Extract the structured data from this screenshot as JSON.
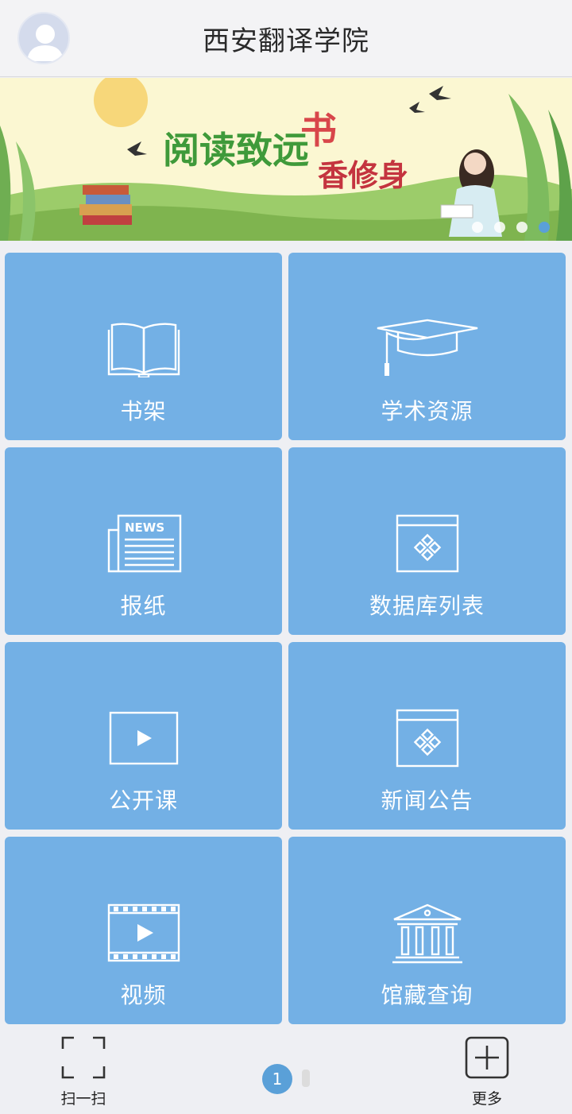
{
  "header": {
    "title": "西安翻译学院"
  },
  "banner": {
    "slogan_left": "阅读致远",
    "slogan_right_top": "书",
    "slogan_right_bottom": "香修身",
    "slide_count": 4,
    "active_slide": 4
  },
  "tiles": [
    {
      "label": "书架",
      "icon": "open-book-icon"
    },
    {
      "label": "学术资源",
      "icon": "graduation-cap-icon"
    },
    {
      "label": "报纸",
      "icon": "newspaper-icon",
      "icon_text": "NEWS"
    },
    {
      "label": "数据库列表",
      "icon": "database-window-icon"
    },
    {
      "label": "公开课",
      "icon": "play-screen-icon"
    },
    {
      "label": "新闻公告",
      "icon": "news-window-icon"
    },
    {
      "label": "视频",
      "icon": "film-play-icon"
    },
    {
      "label": "馆藏查询",
      "icon": "library-building-icon"
    }
  ],
  "bottom_bar": {
    "scan_label": "扫一扫",
    "more_label": "更多",
    "page_number": "1"
  },
  "colors": {
    "tile": "#73b0e5",
    "accent": "#5aa0d8"
  }
}
